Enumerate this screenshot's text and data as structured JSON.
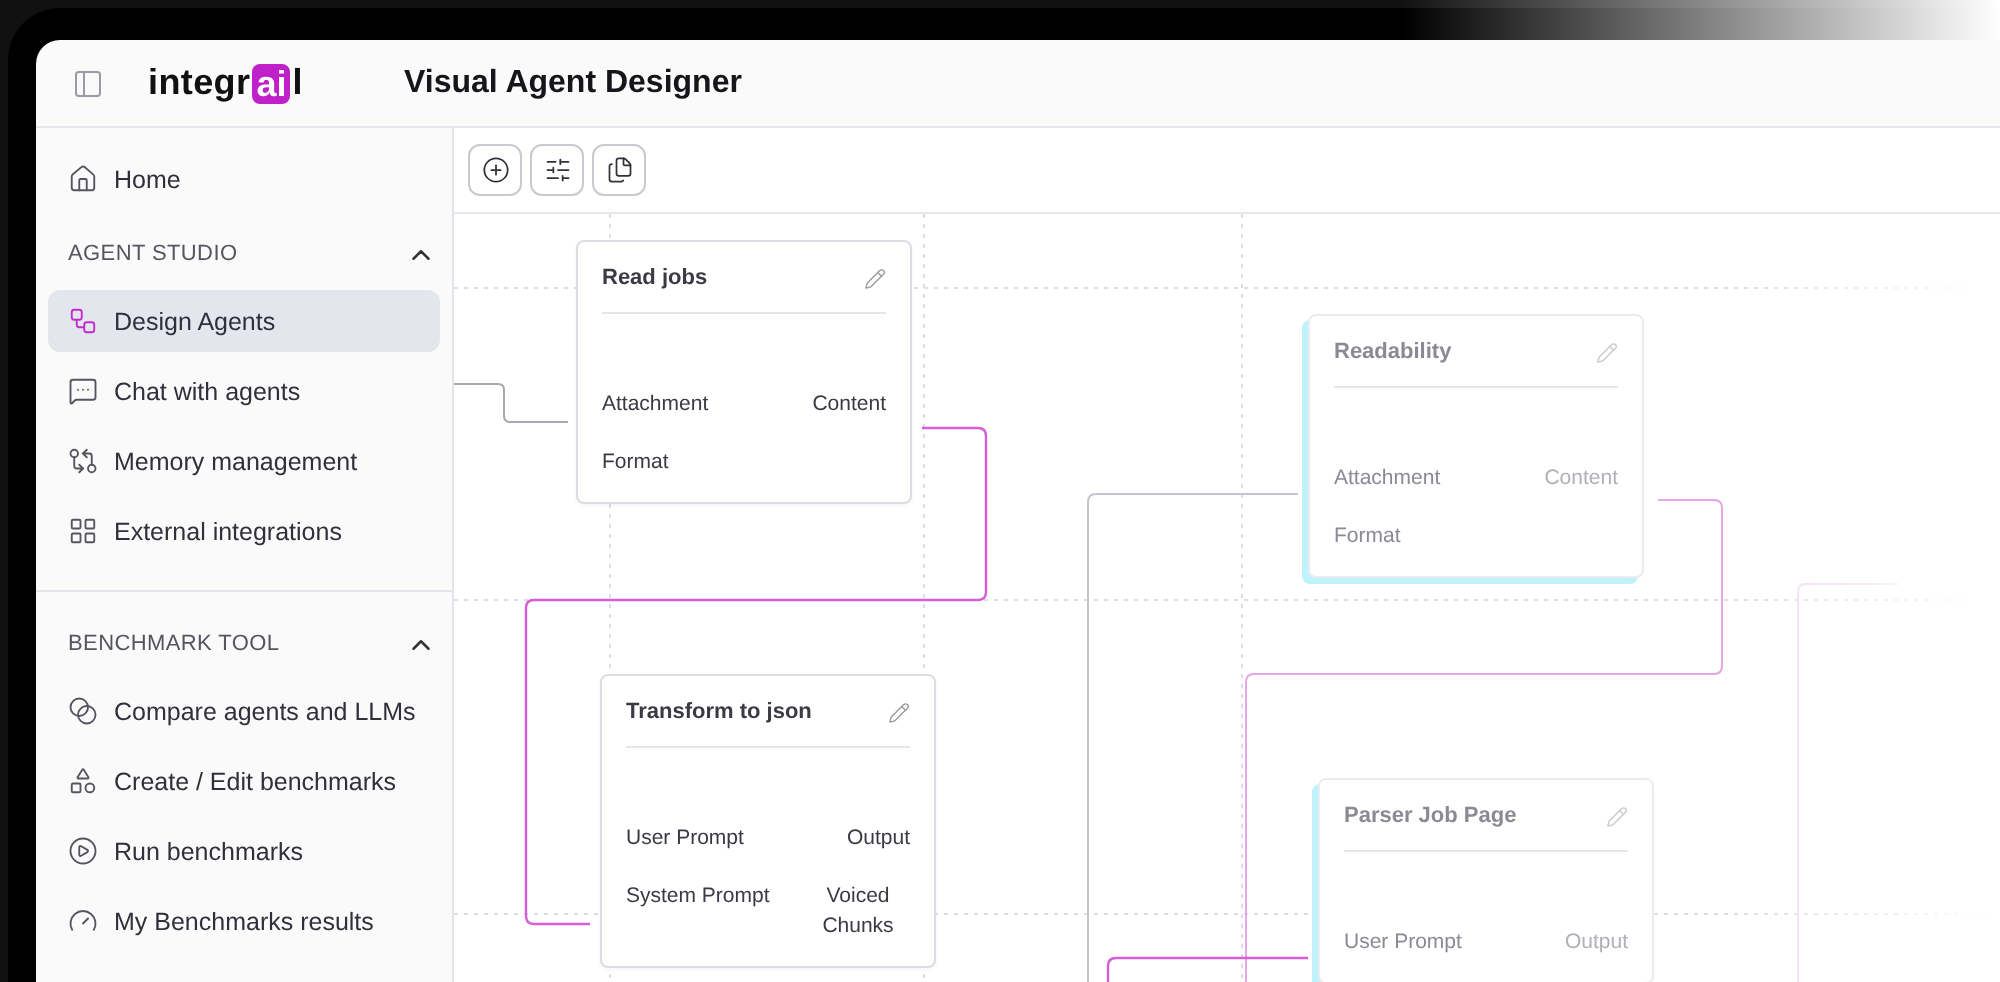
{
  "header": {
    "logo": {
      "before": "integr",
      "highlight": "ai",
      "after": "l"
    },
    "title": "Visual Agent Designer"
  },
  "sidebar": {
    "home": {
      "label": "Home",
      "selected": false
    },
    "sections": [
      {
        "title": "AGENT STUDIO",
        "expanded": true,
        "items": [
          {
            "label": "Design Agents",
            "selected": true
          },
          {
            "label": "Chat with agents",
            "selected": false
          },
          {
            "label": "Memory management",
            "selected": false
          },
          {
            "label": "External integrations",
            "selected": false
          }
        ]
      },
      {
        "title": "BENCHMARK TOOL",
        "expanded": true,
        "items": [
          {
            "label": "Compare agents and LLMs",
            "selected": false
          },
          {
            "label": "Create / Edit benchmarks",
            "selected": false
          },
          {
            "label": "Run benchmarks",
            "selected": false
          },
          {
            "label": "My Benchmarks results",
            "selected": false
          }
        ]
      }
    ]
  },
  "nodes": [
    {
      "title": "Read jobs",
      "dimmed": false,
      "inputs": [
        "Attachment",
        "Format"
      ],
      "outputs": [
        "Content"
      ]
    },
    {
      "title": "Readability",
      "dimmed": true,
      "inputs": [
        "Attachment",
        "Format"
      ],
      "outputs": [
        "Content"
      ]
    },
    {
      "title": "Transform to json",
      "dimmed": false,
      "inputs": [
        "User Prompt",
        "System Prompt"
      ],
      "outputs": [
        "Output",
        "Voiced Chunks"
      ]
    },
    {
      "title": "Parser Job Page",
      "dimmed": true,
      "inputs": [
        "User Prompt"
      ],
      "outputs": [
        "Output"
      ]
    }
  ]
}
